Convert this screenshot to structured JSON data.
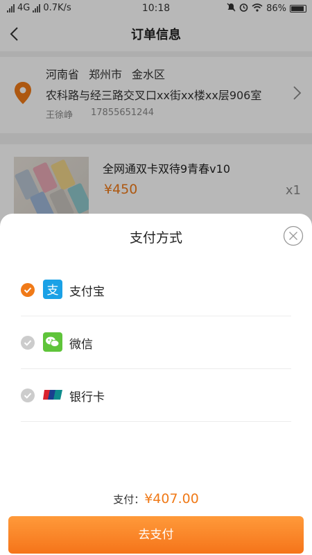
{
  "status_bar": {
    "network": "4G",
    "speed": "0.7K/s",
    "time": "10:18",
    "battery": "86%"
  },
  "header": {
    "title": "订单信息"
  },
  "address": {
    "province": "河南省",
    "city": "郑州市",
    "district": "金水区",
    "street": "农科路与经三路交叉口xx街xx楼xx层906室",
    "name": "王徐峥",
    "phone": "17855651244"
  },
  "product": {
    "name": "全网通双卡双待9青春v10",
    "price": "¥450",
    "quantity": "x1"
  },
  "payment_sheet": {
    "title": "支付方式",
    "options": [
      {
        "label": "支付宝",
        "selected": true,
        "icon": "alipay-icon",
        "color": "#1aa1e6"
      },
      {
        "label": "微信",
        "selected": false,
        "icon": "wechat-icon",
        "color": "#5fc43a"
      },
      {
        "label": "银行卡",
        "selected": false,
        "icon": "unionpay-icon",
        "color": "#d9232e"
      }
    ],
    "total_label": "支付：",
    "total_amount": "¥407.00",
    "submit_label": "去支付"
  },
  "colors": {
    "accent": "#f07a18",
    "radio_inactive": "#cccccc"
  }
}
